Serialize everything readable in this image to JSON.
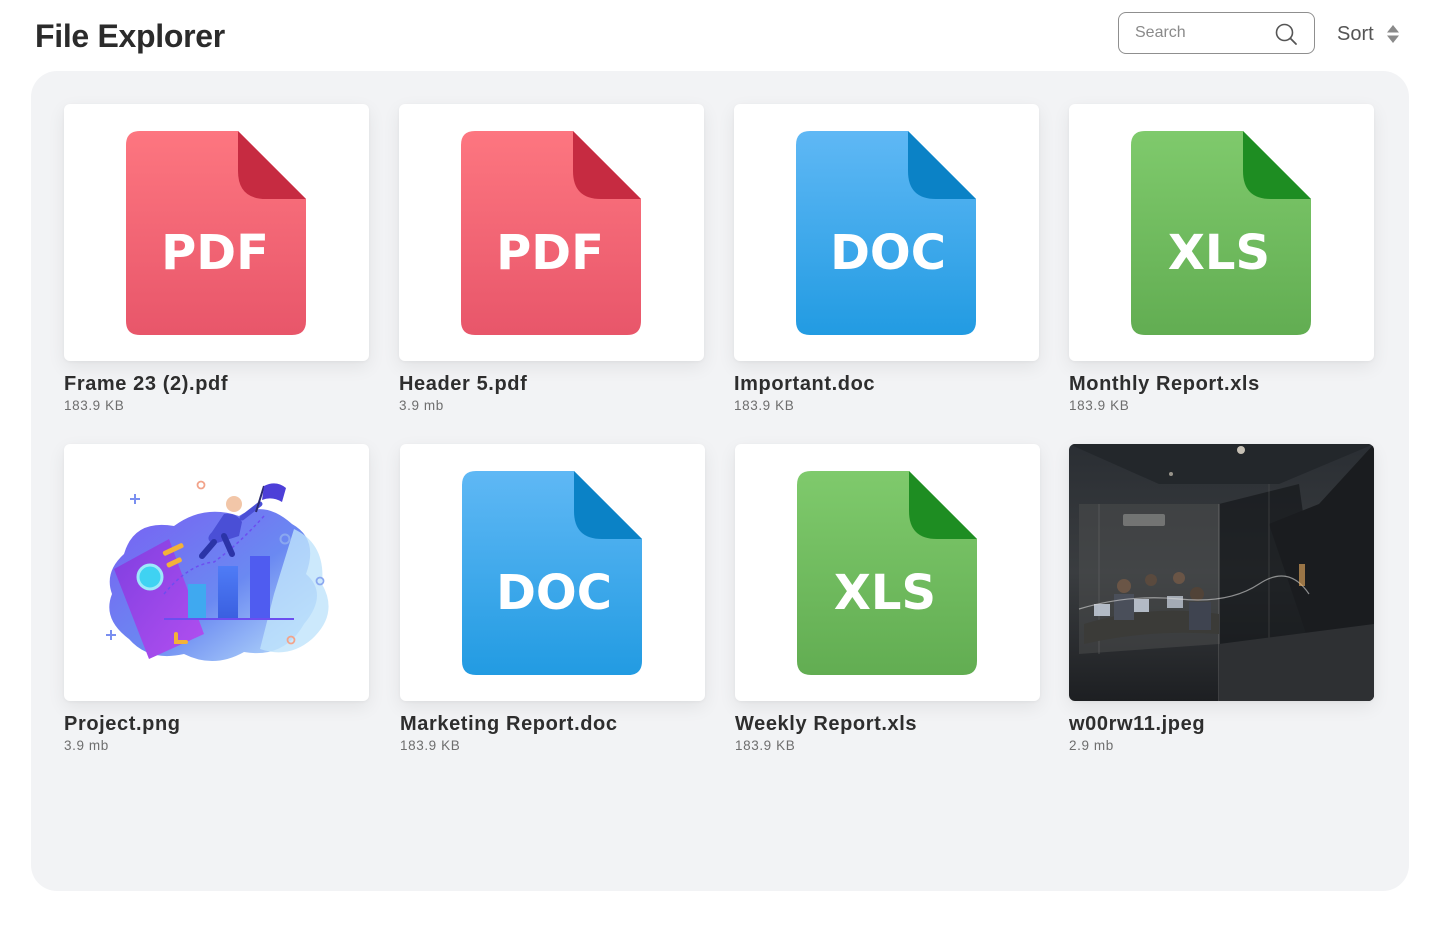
{
  "header": {
    "title": "File Explorer",
    "search_placeholder": "Search",
    "search_value": "",
    "sort_label": "Sort"
  },
  "colors": {
    "pdf": "#f06a78",
    "doc": "#36a4ec",
    "xls": "#6bbd5c",
    "panel": "#f2f3f5"
  },
  "files": [
    {
      "name": "Frame 23 (2).pdf",
      "size": "183.9 KB",
      "type": "PDF",
      "icon": "pdf-file-icon"
    },
    {
      "name": "Header 5.pdf",
      "size": "3.9 mb",
      "type": "PDF",
      "icon": "pdf-file-icon"
    },
    {
      "name": "Important.doc",
      "size": "183.9 KB",
      "type": "DOC",
      "icon": "doc-file-icon"
    },
    {
      "name": "Monthly Report.xls",
      "size": "183.9 KB",
      "type": "XLS",
      "icon": "xls-file-icon"
    },
    {
      "name": "Project.png",
      "size": "3.9 mb",
      "type": "PNG",
      "icon": "project-illustration-image"
    },
    {
      "name": "Marketing Report.doc",
      "size": "183.9 KB",
      "type": "DOC",
      "icon": "doc-file-icon"
    },
    {
      "name": "Weekly Report.xls",
      "size": "183.9 KB",
      "type": "XLS",
      "icon": "xls-file-icon"
    },
    {
      "name": "w00rw11.jpeg",
      "size": "2.9 mb",
      "type": "JPEG",
      "icon": "office-photo-image"
    }
  ]
}
